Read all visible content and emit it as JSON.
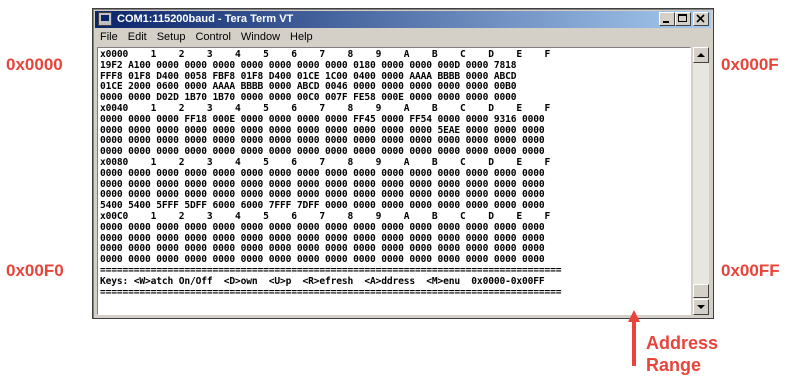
{
  "annotations": {
    "top_left": "0x0000",
    "top_right": "0x000F",
    "bottom_left": "0x00F0",
    "bottom_right": "0x00FF",
    "address_range_line1": "Address",
    "address_range_line2": "Range",
    "color": "#e8443a"
  },
  "window": {
    "title": "COM1:115200baud - Tera Term VT",
    "controls": [
      "minimize-icon",
      "maximize-icon",
      "close-icon"
    ]
  },
  "menu": [
    "File",
    "Edit",
    "Setup",
    "Control",
    "Window",
    "Help"
  ],
  "terminal": {
    "lines": [
      "x0000    1    2    3    4    5    6    7    8    9    A    B    C    D    E    F",
      "19F2 A100 0000 0000 0000 0000 0000 0000 0000 0180 0000 0000 000D 0000 7818",
      "FFF8 01F8 D400 0058 FBF8 01F8 D400 01CE 1C00 0400 0000 AAAA BBBB 0000 ABCD",
      "01CE 2000 0600 0000 AAAA BBBB 0000 ABCD 0046 0000 0000 0000 0000 0000 00B0",
      "0000 0000 D02D 1B70 1B70 0000 0000 00C0 007F FE58 000E 0000 0000 0000 0000",
      "x0040    1    2    3    4    5    6    7    8    9    A    B    C    D    E    F",
      "0000 0000 0000 FF18 000E 0000 0000 0000 0000 FF45 0000 FF54 0000 0000 9316 0000",
      "0000 0000 0000 0000 0000 0000 0000 0000 0000 0000 0000 0000 5EAE 0000 0000 0000",
      "0000 0000 0000 0000 0000 0000 0000 0000 0000 0000 0000 0000 0000 0000 0000 0000",
      "0000 0000 0000 0000 0000 0000 0000 0000 0000 0000 0000 0000 0000 0000 0000 0000",
      "x0080    1    2    3    4    5    6    7    8    9    A    B    C    D    E    F",
      "0000 0000 0000 0000 0000 0000 0000 0000 0000 0000 0000 0000 0000 0000 0000 0000",
      "0000 0000 0000 0000 0000 0000 0000 0000 0000 0000 0000 0000 0000 0000 0000 0000",
      "0000 0000 0000 0000 0000 0000 0000 0000 0000 0000 0000 0000 0000 0000 0000 0000",
      "5400 5400 5FFF 5DFF 6000 6000 7FFF 7DFF 0000 0000 0000 0000 0000 0000 0000 0000",
      "x00C0    1    2    3    4    5    6    7    8    9    A    B    C    D    E    F",
      "0000 0000 0000 0000 0000 0000 0000 0000 0000 0000 0000 0000 0000 0000 0000 0000",
      "0000 0000 0000 0000 0000 0000 0000 0000 0000 0000 0000 0000 0000 0000 0000 0000",
      "0000 0000 0000 0000 0000 0000 0000 0000 0000 0000 0000 0000 0000 0000 0000 0000",
      "0000 0000 0000 0000 0000 0000 0000 0000 0000 0000 0000 0000 0000 0000 0000 0000",
      "==================================================================================",
      "Keys: <W>atch On/Off  <D>own  <U>p  <R>efresh  <A>ddress  <M>enu  0x0000-0x00FF",
      "==================================================================================",
      ""
    ]
  }
}
